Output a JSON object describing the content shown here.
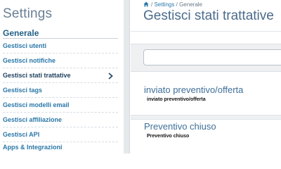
{
  "sidebar": {
    "title": "Settings",
    "section_heading": "Generale",
    "items": [
      {
        "label": "Gestisci utenti"
      },
      {
        "label": "Gestisci notifiche"
      },
      {
        "label": "Gestisci stati trattative",
        "active": true
      },
      {
        "label": "Gestisci tags"
      },
      {
        "label": "Gestisci modelli email"
      },
      {
        "label": "Gestisci affiliazione"
      },
      {
        "label": "Gestisci API"
      },
      {
        "label": "Apps & Integrazioni"
      }
    ],
    "active_indicator_icon": "chevron-right-icon"
  },
  "breadcrumb": {
    "home_icon": "home-icon",
    "separator": "/",
    "parent": "Settings",
    "current": "Generale"
  },
  "main": {
    "title": "Gestisci stati trattative",
    "search": {
      "placeholder": "",
      "value": ""
    },
    "statuses": [
      {
        "title": "inviato preventivo/offerta",
        "label": "inviato preventivo/offerta"
      },
      {
        "title": "Preventivo chiuso",
        "label": "Preventivo chiuso"
      }
    ]
  },
  "colors": {
    "accent": "#2a77a8",
    "heading": "#1f5f86",
    "title": "#6a7f94",
    "gutter": "#e6e9ec"
  }
}
